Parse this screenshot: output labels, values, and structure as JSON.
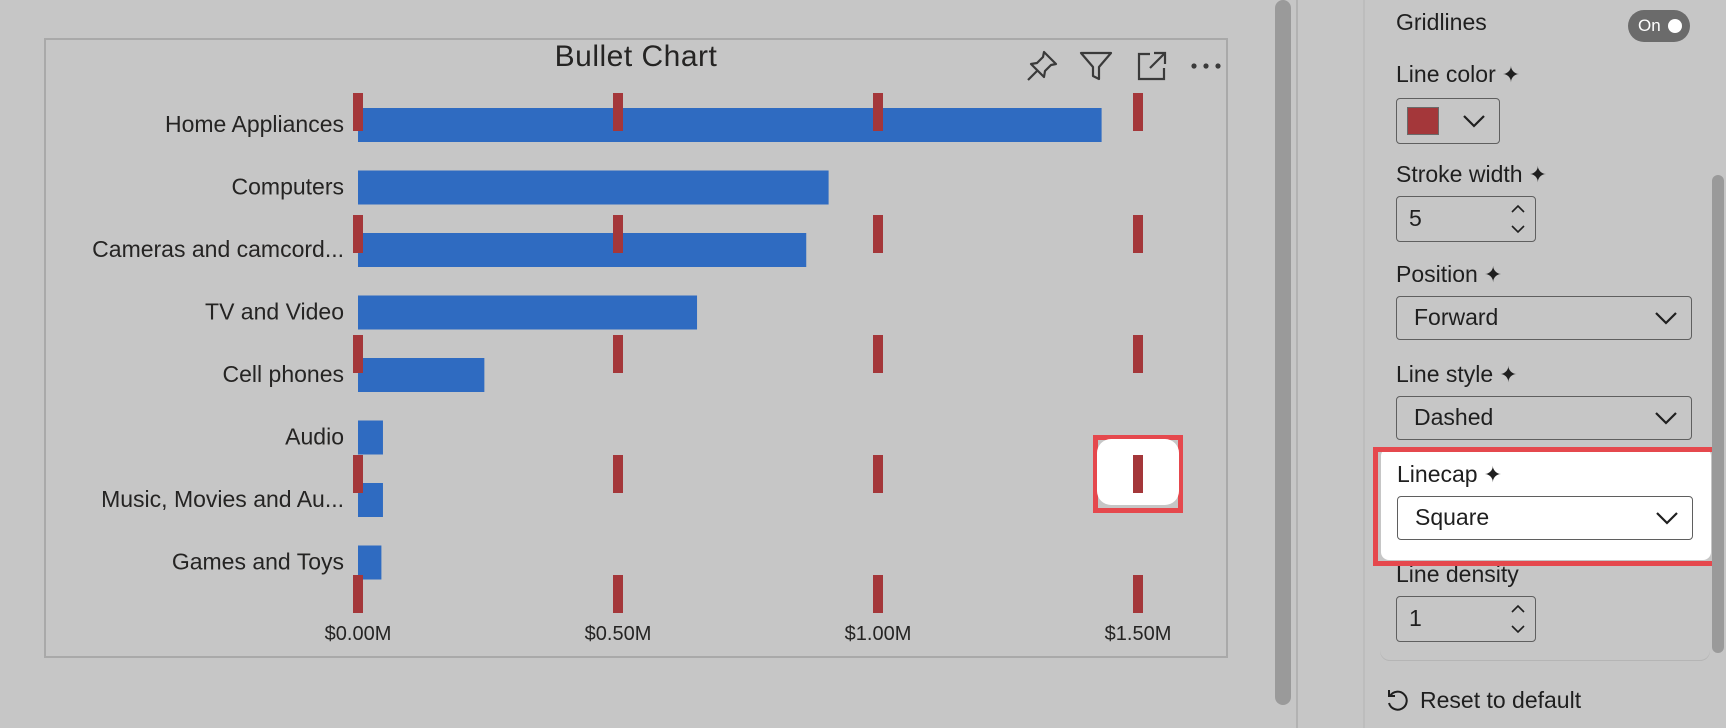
{
  "visual": {
    "title": "Bullet Chart",
    "header_icons": [
      "pin-icon",
      "filter-icon",
      "focus-mode-icon",
      "more-options-icon"
    ]
  },
  "chart_data": {
    "type": "bar",
    "orientation": "horizontal",
    "title": "Bullet Chart",
    "categories": [
      "Home Appliances",
      "Computers",
      "Cameras and camcord...",
      "TV and Video",
      "Cell phones",
      "Audio",
      "Music, Movies and Au...",
      "Games and Toys"
    ],
    "values": [
      1.43,
      0.905,
      0.862,
      0.652,
      0.243,
      0.048,
      0.048,
      0.045
    ],
    "value_unit": "$M",
    "xlim": [
      0,
      1.5
    ],
    "x_ticks": [
      0,
      0.5,
      1.0,
      1.5
    ],
    "x_tick_labels": [
      "$0.00M",
      "$0.50M",
      "$1.00M",
      "$1.50M"
    ],
    "gridlines": {
      "visible": true,
      "style": "dashed",
      "color": "#a4373a",
      "linecap": "square"
    },
    "bar_color": "#2f6bc1"
  },
  "format_pane": {
    "gridlines_label": "Gridlines",
    "gridlines_toggle": "On",
    "line_color_label": "Line color",
    "line_color_value": "#a4373a",
    "stroke_width_label": "Stroke width",
    "stroke_width_value": "5",
    "position_label": "Position",
    "position_value": "Forward",
    "line_style_label": "Line style",
    "line_style_value": "Dashed",
    "linecap_label": "Linecap",
    "linecap_value": "Square",
    "line_density_label": "Line density",
    "line_density_value": "1",
    "spark_glyph": "✦",
    "reset_label": "Reset to default"
  }
}
